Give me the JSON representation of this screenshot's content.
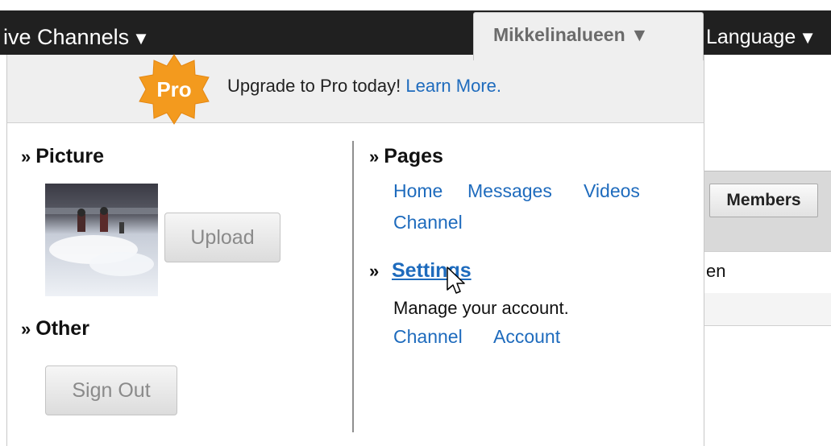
{
  "nav": {
    "channels_label": "ive Channels",
    "language_label": "Language",
    "user_label": "Mikkelinalueen",
    "caret": "▼"
  },
  "promo": {
    "badge_text": "Pro",
    "text": "Upgrade to Pro today!",
    "link": "Learn More."
  },
  "picture": {
    "marker": "»",
    "title": "Picture",
    "upload_label": "Upload"
  },
  "other": {
    "marker": "»",
    "title": "Other",
    "signout_label": "Sign Out"
  },
  "pages": {
    "marker": "»",
    "title": "Pages",
    "links": [
      "Home",
      "Messages",
      "Videos",
      "Channel"
    ]
  },
  "settings": {
    "marker": "»",
    "title": "Settings",
    "description": "Manage your account.",
    "links": [
      "Channel",
      "Account"
    ]
  },
  "background": {
    "members_label": "Members",
    "row_text": "en"
  },
  "colors": {
    "link": "#1e6bbd",
    "nav_bg": "#202020",
    "badge": "#f39a1e"
  }
}
